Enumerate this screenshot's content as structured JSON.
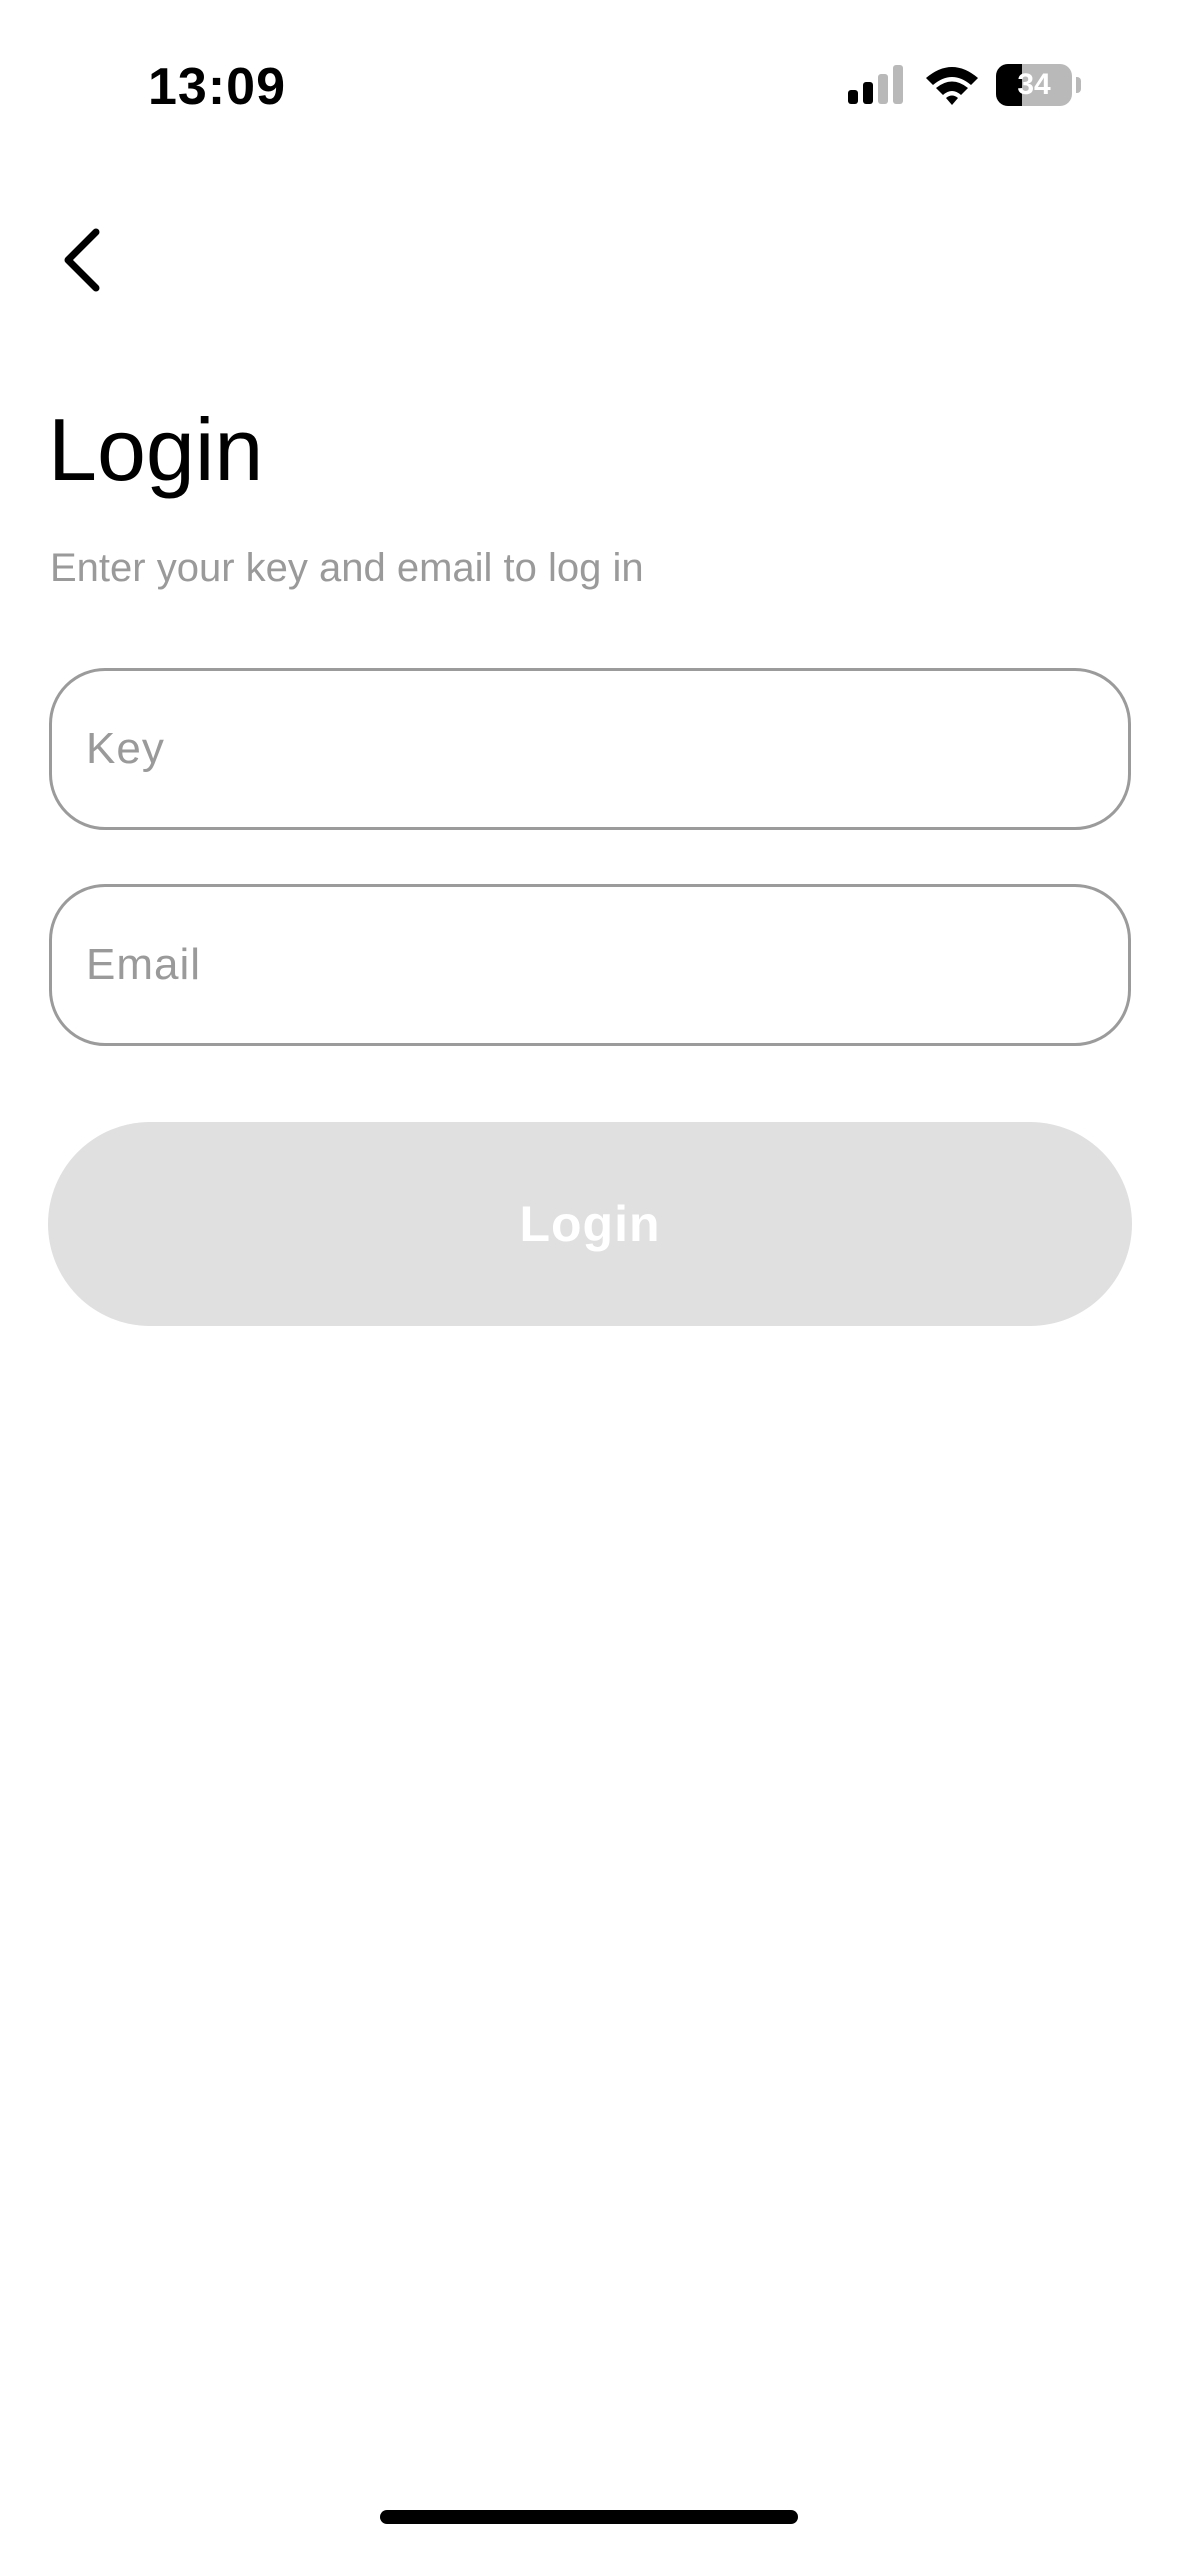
{
  "status_bar": {
    "time": "13:09",
    "battery_level": "34",
    "battery_fraction": 0.34,
    "signal_bars_active": 2,
    "signal_bars_total": 4
  },
  "header": {
    "back_icon": "chevron-left-icon"
  },
  "main": {
    "title": "Login",
    "subtitle": "Enter your key and email to log in",
    "key_field": {
      "placeholder": "Key",
      "value": ""
    },
    "email_field": {
      "placeholder": "Email",
      "value": ""
    },
    "login_button_label": "Login"
  },
  "colors": {
    "button_disabled_bg": "#e0e0e0",
    "field_border": "#9b9b9b",
    "muted_text": "#9a9a9a"
  }
}
